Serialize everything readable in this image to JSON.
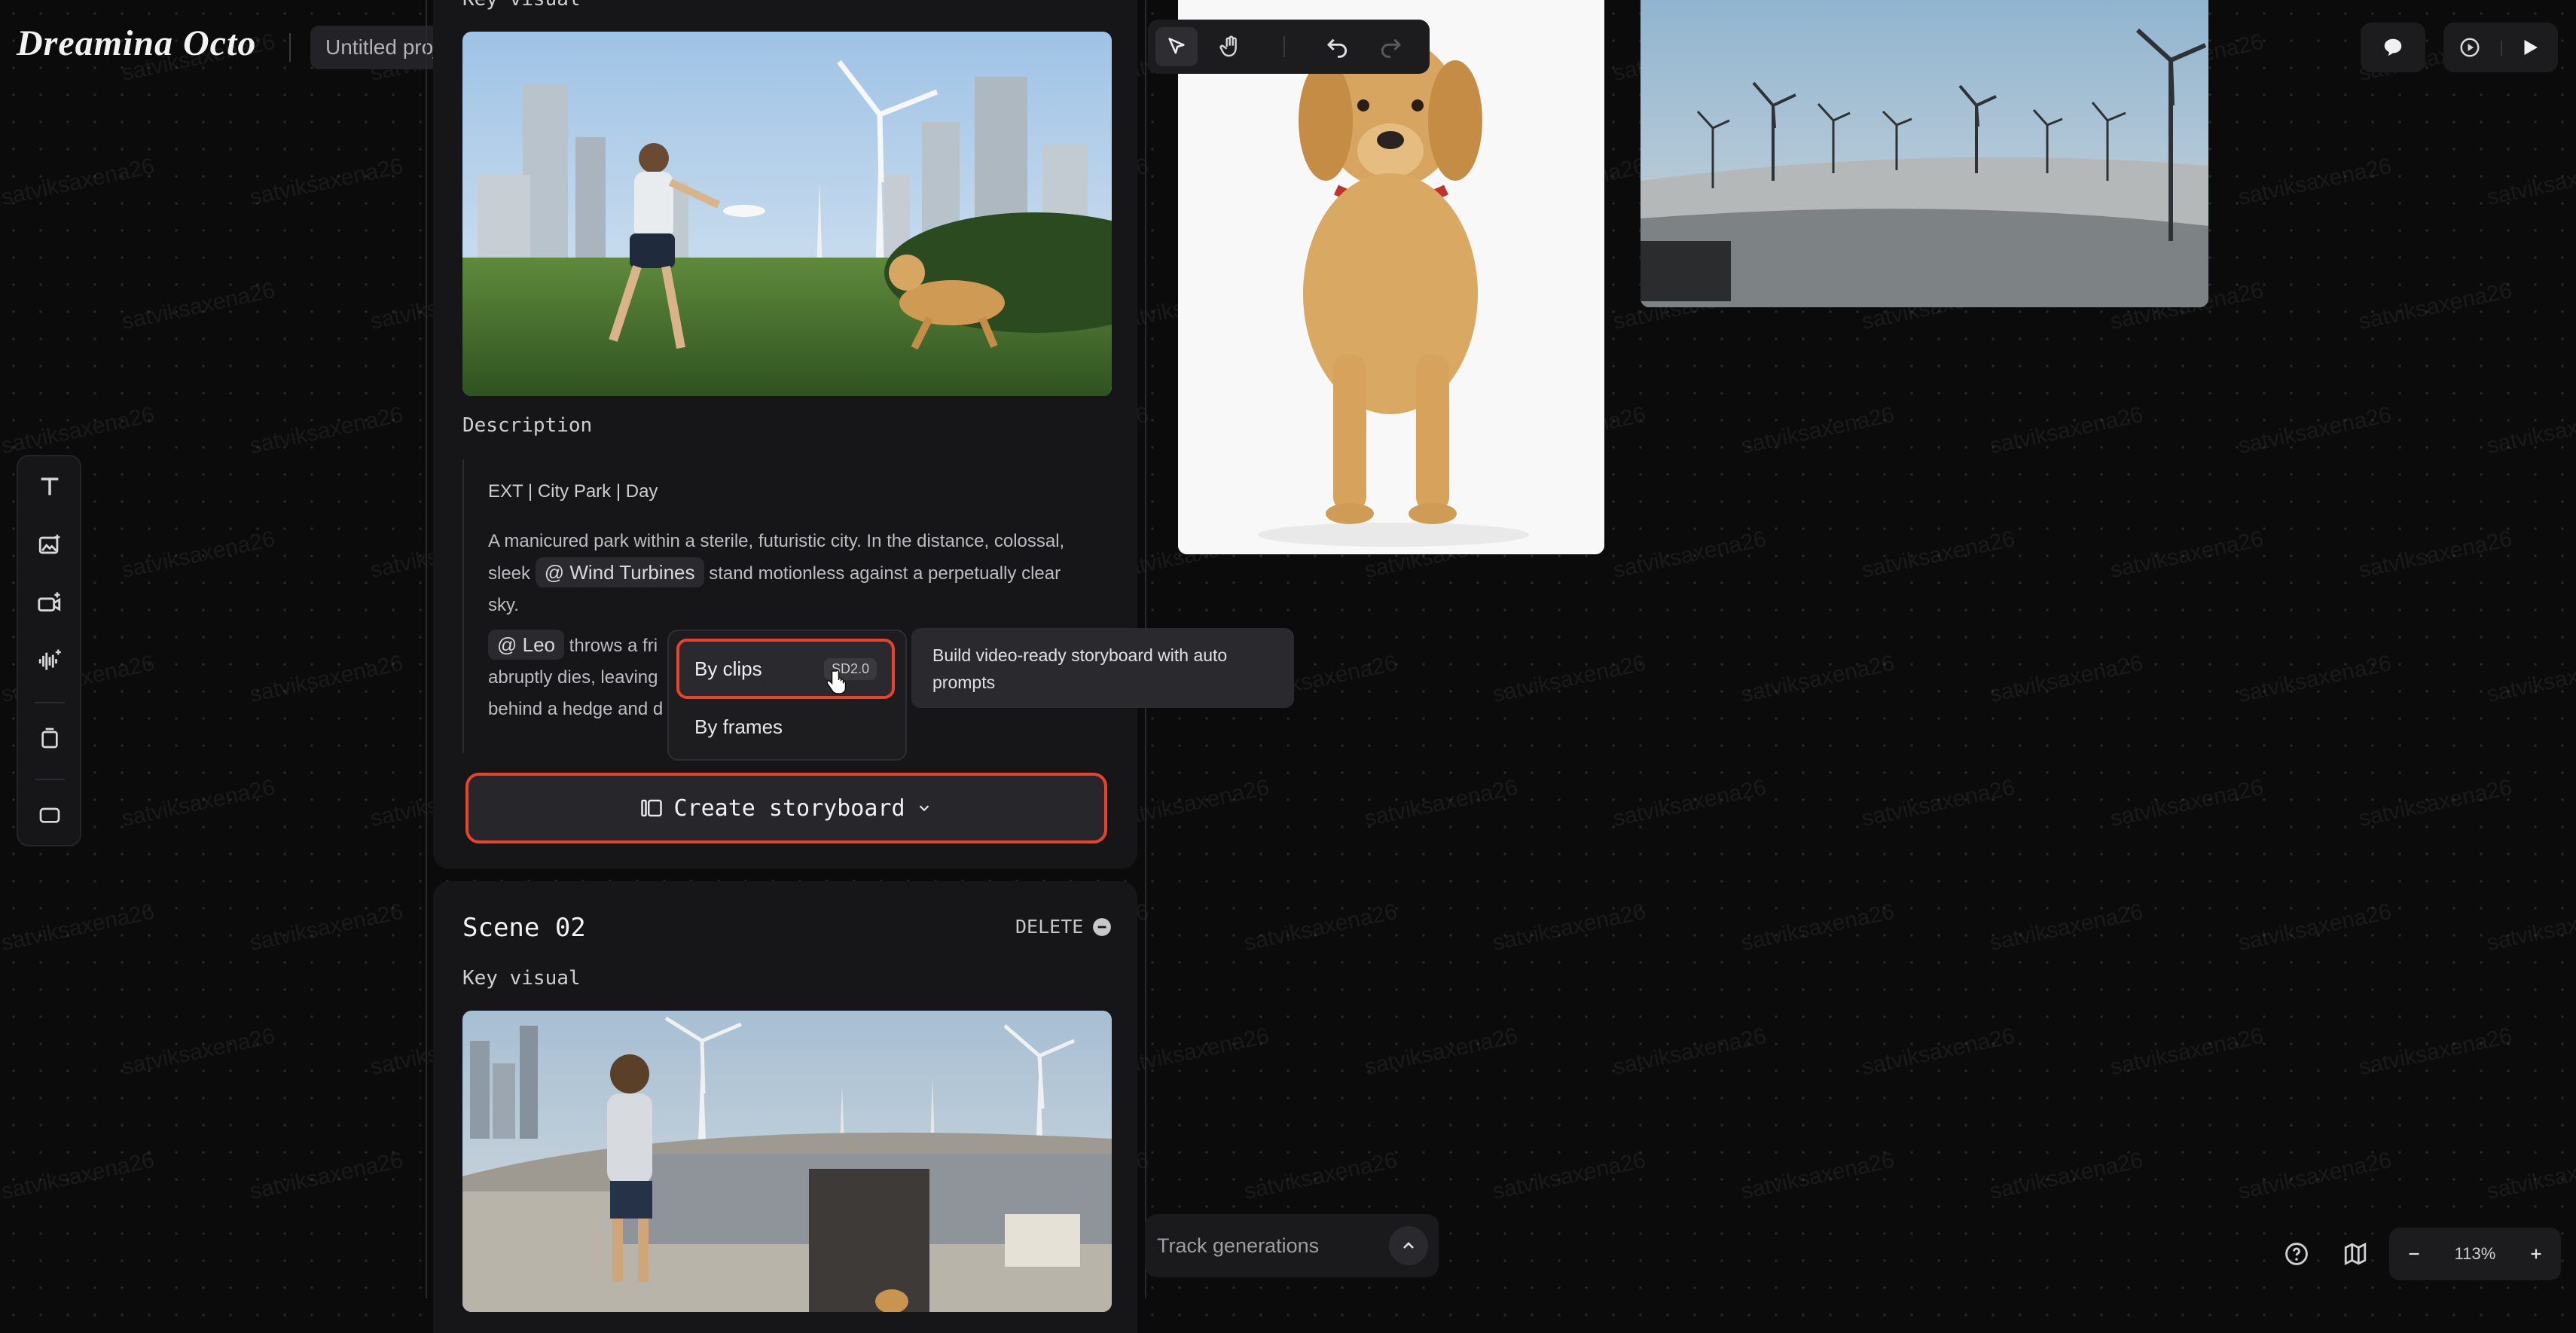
{
  "app": {
    "logo": "Dreamina Octo",
    "project_title": "Untitled project"
  },
  "scene1": {
    "key_visual_label": "Key visual",
    "description_label": "Description",
    "slug": "EXT | City Park | Day",
    "para1_text1": "A manicured park within a sterile, futuristic city. In the distance, colossal,",
    "para1_text2": "sleek",
    "para1_mention": "@ Wind Turbines",
    "para1_text3": "stand motionless against a perpetually clear",
    "para1_text4": "sky.",
    "para2_mention": "@ Leo",
    "para2_text1": "throws a fri",
    "para2_text2": "abruptly dies, leaving",
    "para2_text3": "behind a hedge and d",
    "create_button": "Create storyboard"
  },
  "dropdown": {
    "by_clips": "By clips",
    "badge": "SD2.0",
    "by_frames": "By frames",
    "tooltip": "Build video-ready storyboard with auto prompts"
  },
  "scene2": {
    "title": "Scene 02",
    "delete_label": "DELETE",
    "key_visual_label": "Key visual"
  },
  "bottom": {
    "track_generations": "Track generations",
    "zoom": "113%"
  },
  "watermark": "satviksaxena26",
  "colors": {
    "accent": "#e8442b",
    "background": "#0b0b0c",
    "panel": "#161618"
  }
}
